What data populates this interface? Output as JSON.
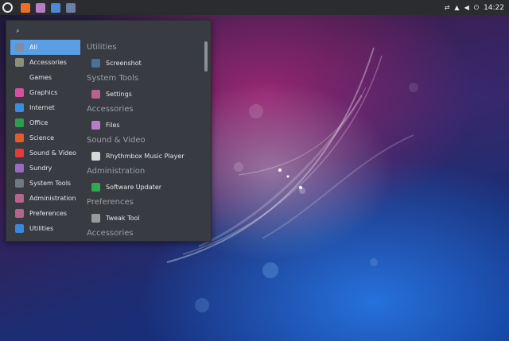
{
  "panel": {
    "clock": "14:22",
    "launchers": [
      {
        "icon": "firefox-icon",
        "color": "#e8702a"
      },
      {
        "icon": "files-icon",
        "color": "#b87cc9"
      },
      {
        "icon": "notes-icon",
        "color": "#4a8ad8"
      },
      {
        "icon": "calendar-icon",
        "color": "#6b7fa8"
      }
    ],
    "tray_icons": [
      "network-icon",
      "notification-bell-icon",
      "volume-icon",
      "power-icon"
    ]
  },
  "menu": {
    "search": {
      "placeholder": ""
    },
    "categories": [
      {
        "label": "All",
        "icon": "all-icon",
        "color": "#7f8ea3",
        "active": true
      },
      {
        "label": "Accessories",
        "icon": "accessories-icon",
        "color": "#8a8f7a"
      },
      {
        "label": "Games",
        "icon": "games-icon",
        "color": "#3b3b3b"
      },
      {
        "label": "Graphics",
        "icon": "graphics-icon",
        "color": "#d94fa0"
      },
      {
        "label": "Internet",
        "icon": "internet-icon",
        "color": "#3a8ce0"
      },
      {
        "label": "Office",
        "icon": "office-icon",
        "color": "#2f9b52"
      },
      {
        "label": "Science",
        "icon": "science-icon",
        "color": "#e35a2f"
      },
      {
        "label": "Sound & Video",
        "icon": "sound-video-icon",
        "color": "#e23b3b"
      },
      {
        "label": "Sundry",
        "icon": "sundry-icon",
        "color": "#9a6ac2"
      },
      {
        "label": "System Tools",
        "icon": "system-tools-icon",
        "color": "#6f7780"
      },
      {
        "label": "Administration",
        "icon": "administration-icon",
        "color": "#b6638e"
      },
      {
        "label": "Preferences",
        "icon": "preferences-icon",
        "color": "#b6638e"
      },
      {
        "label": "Utilities",
        "icon": "utilities-icon",
        "color": "#3d87d8"
      }
    ],
    "sections": [
      {
        "heading": "Utilities",
        "apps": [
          {
            "label": "Screenshot",
            "icon": "screenshot-icon",
            "color": "#4c6f9c"
          }
        ]
      },
      {
        "heading": "System Tools",
        "apps": [
          {
            "label": "Settings",
            "icon": "settings-icon",
            "color": "#b6638e"
          }
        ]
      },
      {
        "heading": "Accessories",
        "apps": [
          {
            "label": "Files",
            "icon": "files-icon",
            "color": "#b87cc9"
          }
        ]
      },
      {
        "heading": "Sound & Video",
        "apps": [
          {
            "label": "Rhythmbox Music Player",
            "icon": "music-icon",
            "color": "#d8d8d8"
          }
        ]
      },
      {
        "heading": "Administration",
        "apps": [
          {
            "label": "Software Updater",
            "icon": "updater-icon",
            "color": "#2fa84f"
          }
        ]
      },
      {
        "heading": "Preferences",
        "apps": [
          {
            "label": "Tweak Tool",
            "icon": "tweak-icon",
            "color": "#9a9a9a"
          }
        ]
      },
      {
        "heading": "Accessories",
        "apps": []
      }
    ]
  }
}
